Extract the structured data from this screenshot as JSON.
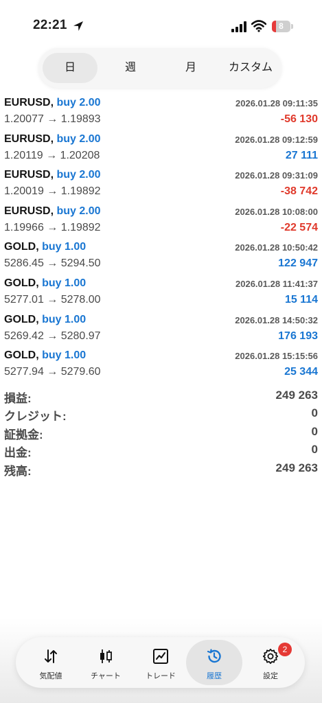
{
  "status_bar": {
    "time": "22:21",
    "battery": "8"
  },
  "periods": {
    "items": [
      "日",
      "週",
      "月",
      "カスタム"
    ],
    "selected": "日"
  },
  "trades": [
    {
      "symbol": "EURUSD",
      "direction": "buy 2.00",
      "datetime": "2026.01.28 09:11:35",
      "open_price": "1.20077",
      "close_price": "1.19893",
      "profit": "-56 130",
      "sign": "neg"
    },
    {
      "symbol": "EURUSD",
      "direction": "buy 2.00",
      "datetime": "2026.01.28 09:12:59",
      "open_price": "1.20119",
      "close_price": "1.20208",
      "profit": "27 111",
      "sign": "pos"
    },
    {
      "symbol": "EURUSD",
      "direction": "buy 2.00",
      "datetime": "2026.01.28 09:31:09",
      "open_price": "1.20019",
      "close_price": "1.19892",
      "profit": "-38 742",
      "sign": "neg"
    },
    {
      "symbol": "EURUSD",
      "direction": "buy 2.00",
      "datetime": "2026.01.28 10:08:00",
      "open_price": "1.19966",
      "close_price": "1.19892",
      "profit": "-22 574",
      "sign": "neg"
    },
    {
      "symbol": "GOLD",
      "direction": "buy 1.00",
      "datetime": "2026.01.28 10:50:42",
      "open_price": "5286.45",
      "close_price": "5294.50",
      "profit": "122 947",
      "sign": "pos"
    },
    {
      "symbol": "GOLD",
      "direction": "buy 1.00",
      "datetime": "2026.01.28 11:41:37",
      "open_price": "5277.01",
      "close_price": "5278.00",
      "profit": "15 114",
      "sign": "pos"
    },
    {
      "symbol": "GOLD",
      "direction": "buy 1.00",
      "datetime": "2026.01.28 14:50:32",
      "open_price": "5269.42",
      "close_price": "5280.97",
      "profit": "176 193",
      "sign": "pos"
    },
    {
      "symbol": "GOLD",
      "direction": "buy 1.00",
      "datetime": "2026.01.28 15:15:56",
      "open_price": "5277.94",
      "close_price": "5279.60",
      "profit": "25 344",
      "sign": "pos"
    }
  ],
  "summary": [
    {
      "label": "損益:",
      "value": "249 263"
    },
    {
      "label": "クレジット:",
      "value": "0"
    },
    {
      "label": "証拠金:",
      "value": "0"
    },
    {
      "label": "出金:",
      "value": "0"
    },
    {
      "label": "残高:",
      "value": "249 263"
    }
  ],
  "bottom_nav": {
    "items": [
      {
        "label": "気配値",
        "icon": "quotes-arrows-icon"
      },
      {
        "label": "チャート",
        "icon": "candlestick-icon"
      },
      {
        "label": "トレード",
        "icon": "trade-chart-icon"
      },
      {
        "label": "履歴",
        "icon": "history-clock-icon"
      },
      {
        "label": "設定",
        "icon": "gear-icon",
        "badge": "2"
      }
    ],
    "active": "履歴"
  },
  "colors": {
    "accent": "#1976d2",
    "loss": "#e0392b",
    "badge": "#e53935"
  }
}
